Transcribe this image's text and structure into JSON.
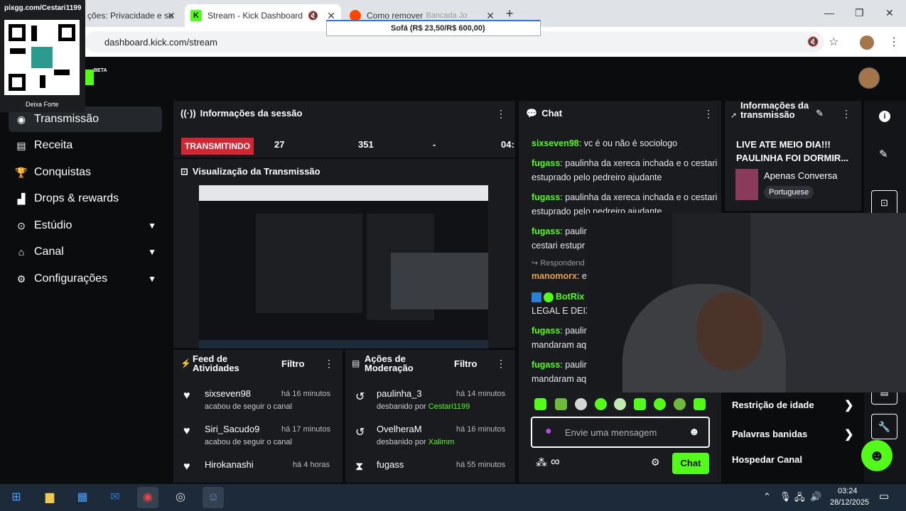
{
  "browser": {
    "tabs": [
      {
        "label": "ções: Privacidade e se"
      },
      {
        "label": "Stream - Kick Dashboard"
      },
      {
        "label": "Como remover"
      }
    ],
    "tab_overlay_text": "Bancada Jo",
    "url": "dashboard.kick.com/stream"
  },
  "overlay": {
    "pix_label": "pixgg.com/Cestari1199",
    "pix_sub": "Deixa Forte",
    "goal_bar": "Sofá (R$ 23,50/R$ 600,00)"
  },
  "brand": {
    "beta": "BETA"
  },
  "sidebar": {
    "items": [
      {
        "label": "Transmissão",
        "icon": "broadcast-icon"
      },
      {
        "label": "Receita",
        "icon": "receipt-icon"
      },
      {
        "label": "Conquistas",
        "icon": "trophy-icon"
      },
      {
        "label": "Drops & rewards",
        "icon": "drops-icon"
      },
      {
        "label": "Estúdio",
        "icon": "studio-icon"
      },
      {
        "label": "Canal",
        "icon": "channel-icon"
      },
      {
        "label": "Configurações",
        "icon": "gear-icon"
      }
    ]
  },
  "session": {
    "title": "Informações da sessão",
    "status": "TRANSMITINDO",
    "stats": [
      "27",
      "351",
      "-",
      "04:"
    ]
  },
  "preview": {
    "title": "Visualização da Transmissão"
  },
  "activity_feed": {
    "title": "Feed de Atividades",
    "filter": "Filtro",
    "items": [
      {
        "user": "sixseven98",
        "time": "há 16 minutos",
        "desc": "acabou de seguir o canal"
      },
      {
        "user": "Siri_Sacudo9",
        "time": "há 17 minutos",
        "desc": "acabou de seguir o canal"
      },
      {
        "user": "Hirokanashi",
        "time": "há 4 horas",
        "desc": ""
      }
    ]
  },
  "moderation": {
    "title": "Ações de Moderação",
    "filter": "Filtro",
    "items": [
      {
        "user": "paulinha_3",
        "time": "há 14 minutos",
        "desc": "desbanido por ",
        "by": "Cestari1199"
      },
      {
        "user": "OvelheraM",
        "time": "há 16 minutos",
        "desc": "desbanido por ",
        "by": "Xalimm"
      },
      {
        "user": "fugass",
        "time": "há 55 minutos",
        "desc": "",
        "by": ""
      }
    ]
  },
  "chat": {
    "title": "Chat",
    "messages": [
      {
        "user": "sixseven98",
        "text": "vc é ou não é sociologo"
      },
      {
        "user": "fugass",
        "text": "paulinha da xereca inchada e o cestari estuprado pelo pedreiro ajudante"
      },
      {
        "user": "fugass",
        "text": "paulinha da xereca inchada e o cestari estuprado pelo pedreiro ajudante"
      },
      {
        "user": "fugass",
        "text": "paulinl"
      },
      {
        "user": "",
        "text": "cestari estupr"
      },
      {
        "user": "",
        "text": "Respondend"
      },
      {
        "user": "manomorx",
        "text": "e"
      },
      {
        "user": "BotRix",
        "text": ""
      },
      {
        "user": "",
        "text": "LEGAL E DEIX"
      },
      {
        "user": "fugass",
        "text": "paulir"
      },
      {
        "user": "",
        "text": "mandaram aq"
      },
      {
        "user": "fugass",
        "text": "paulir"
      },
      {
        "user": "",
        "text": "mandaram aq"
      }
    ],
    "input_placeholder": "Envie uma mensagem",
    "send_label": "Chat"
  },
  "stream_info": {
    "title": "Informações da transmissão",
    "stream_title": "LIVE ATE MEIO DIA!!! PAULINHA FOI DORMIR...",
    "category": "Apenas Conversa",
    "language": "Portuguese"
  },
  "right_menu": [
    {
      "label": "Restrição de idade"
    },
    {
      "label": "Palavras banidas"
    },
    {
      "label": "Hospedar Canal"
    }
  ],
  "taskbar": {
    "time": "03:24",
    "date": "28/12/2025"
  },
  "colors": {
    "accent": "#53fc18",
    "live": "#d12634",
    "panel": "#191b1f"
  }
}
